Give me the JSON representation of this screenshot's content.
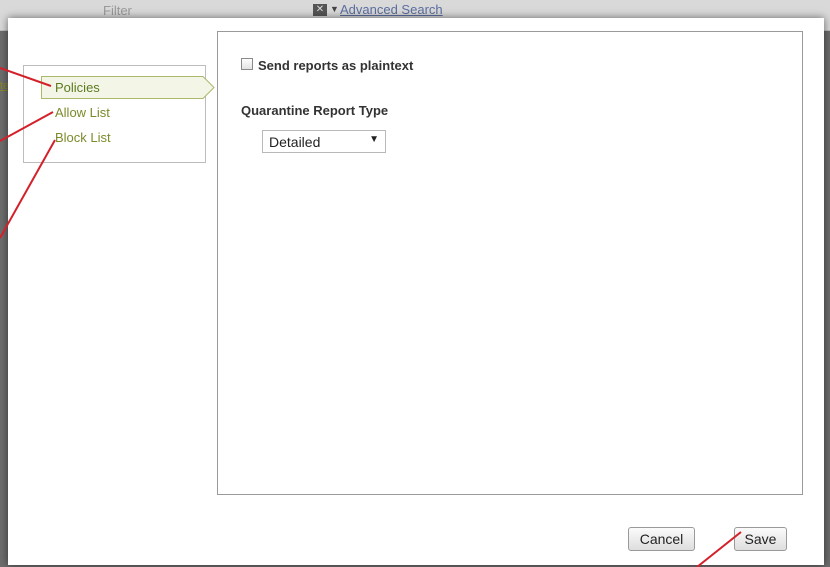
{
  "background": {
    "filter_label": "Filter",
    "advanced_search_label": "Advanced Search",
    "left_link_fragment": "te"
  },
  "sidebar": {
    "items": [
      {
        "label": "Policies",
        "active": true
      },
      {
        "label": "Allow List",
        "active": false
      },
      {
        "label": "Block List",
        "active": false
      }
    ]
  },
  "content": {
    "checkbox_label": "Send reports as plaintext",
    "checkbox_checked": false,
    "report_type_label": "Quarantine Report Type",
    "report_type_value": "Detailed"
  },
  "footer": {
    "cancel_label": "Cancel",
    "save_label": "Save"
  },
  "colors": {
    "nav_text": "#7d8a2a",
    "active_fill": "#f3f6e6",
    "annotation": "#d4202a"
  },
  "icons": [
    "close-icon",
    "dropdown-caret-icon",
    "chevron-down-icon"
  ]
}
